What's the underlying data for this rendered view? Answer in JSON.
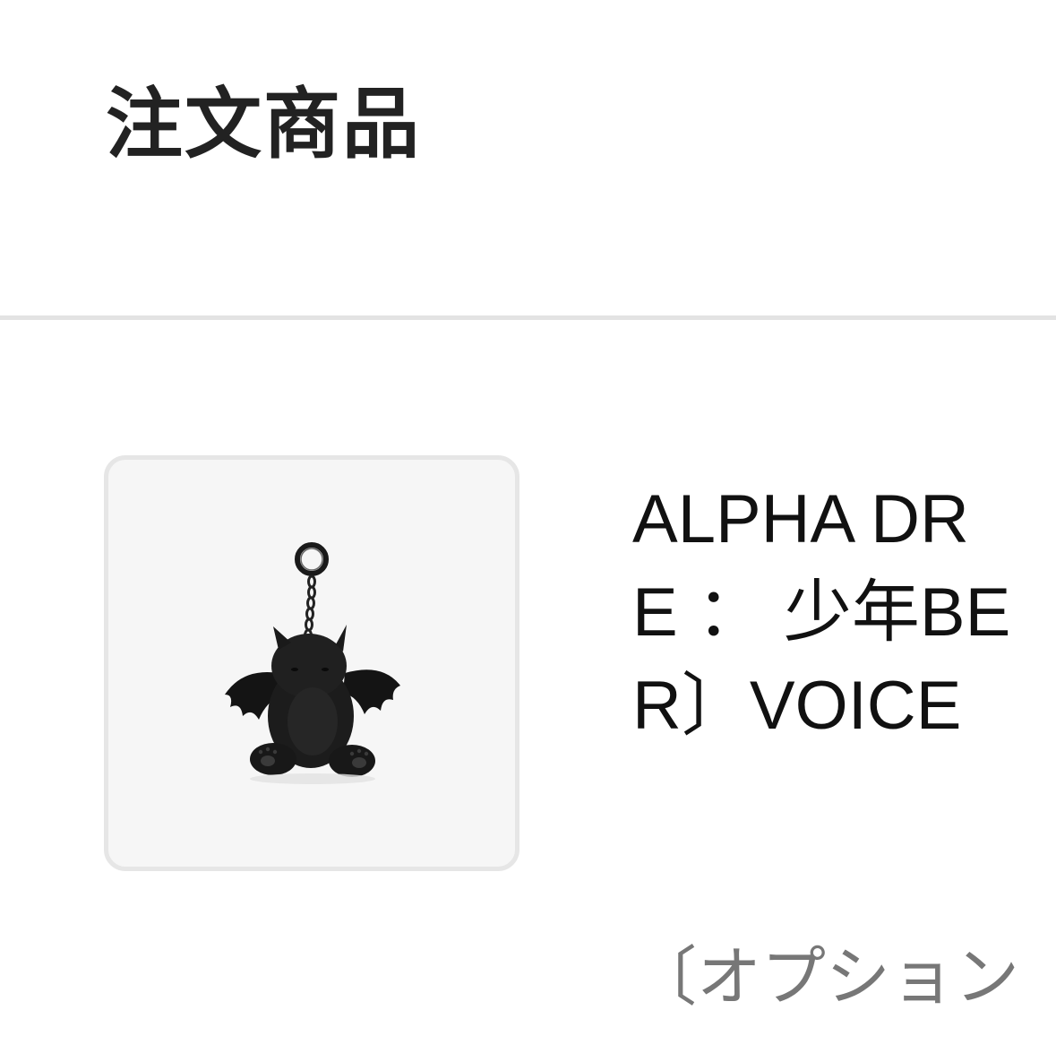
{
  "section": {
    "title": "注文商品"
  },
  "product": {
    "image_icon": "dragon-plush-keychain",
    "name_lines": [
      "ALPHA DR",
      "E ： 少年BE",
      "R〕VOICE"
    ],
    "option_text": "〔オプション"
  },
  "colors": {
    "divider": "#e3e3e3",
    "thumb_bg": "#f6f6f6",
    "text_main": "#111111",
    "text_muted": "#777777"
  }
}
